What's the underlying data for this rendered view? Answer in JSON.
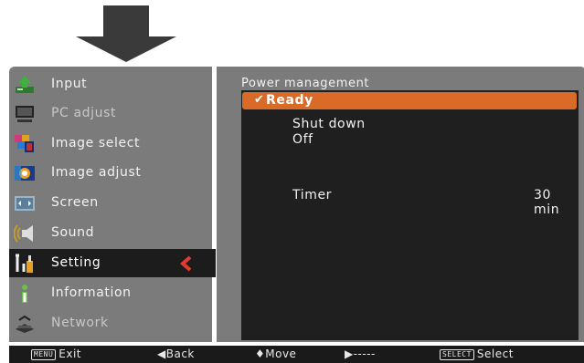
{
  "menu": {
    "items": [
      {
        "label": "Input",
        "icon": "input-icon"
      },
      {
        "label": "PC adjust",
        "icon": "pc-adjust-icon"
      },
      {
        "label": "Image select",
        "icon": "image-select-icon"
      },
      {
        "label": "Image adjust",
        "icon": "image-adjust-icon"
      },
      {
        "label": "Screen",
        "icon": "screen-icon"
      },
      {
        "label": "Sound",
        "icon": "sound-icon"
      },
      {
        "label": "Setting",
        "icon": "setting-icon",
        "active": true
      },
      {
        "label": "Information",
        "icon": "information-icon"
      },
      {
        "label": "Network",
        "icon": "network-icon"
      }
    ]
  },
  "power_management": {
    "title": "Power management",
    "options": [
      "Ready",
      "Shut down",
      "Off"
    ],
    "selected": "Ready",
    "check_mark": "✔",
    "timer_label": "Timer",
    "timer_value": "30 min"
  },
  "help_bar": {
    "exit_key": "MENU",
    "exit": "Exit",
    "back": "◀Back",
    "move": "♦Move",
    "next": "▶-----",
    "select_key": "SELECT",
    "select": "Select"
  },
  "colors": {
    "panel": "#7b7b7b",
    "inner": "#1f1f1f",
    "highlight": "#d96a27",
    "chevron": "#e23b2d"
  }
}
